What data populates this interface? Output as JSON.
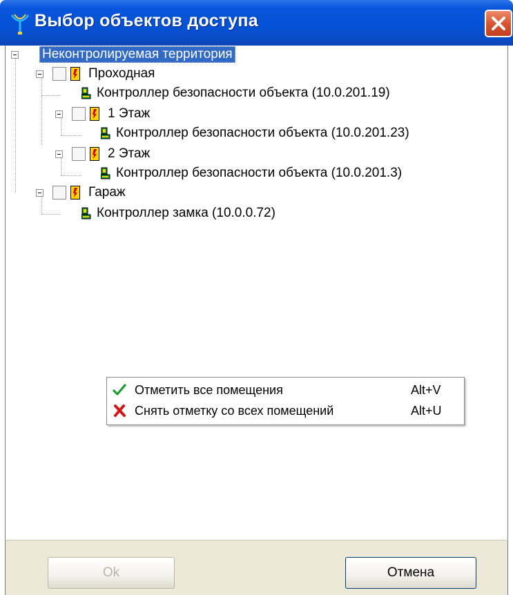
{
  "window": {
    "title": "Выбор объектов доступа"
  },
  "tree": {
    "root": {
      "label": "Неконтролируемая территория",
      "selected": true
    },
    "items": [
      {
        "label": "Проходная",
        "type": "zone",
        "checked": false
      },
      {
        "label": "Контроллер безопасности объекта (10.0.201.19)",
        "type": "controller"
      },
      {
        "label": "1 Этаж",
        "type": "zone",
        "checked": false
      },
      {
        "label": "Контроллер безопасности объекта (10.0.201.23)",
        "type": "controller"
      },
      {
        "label": "2 Этаж",
        "type": "zone",
        "checked": false
      },
      {
        "label": "Контроллер безопасности объекта (10.0.201.3)",
        "type": "controller"
      },
      {
        "label": "Гараж",
        "type": "zone",
        "checked": false
      },
      {
        "label": "Контроллер замка (10.0.0.72)",
        "type": "controller"
      }
    ]
  },
  "context_menu": {
    "items": [
      {
        "label": "Отметить все помещения",
        "shortcut": "Alt+V",
        "icon": "check-icon"
      },
      {
        "label": "Снять отметку со всех помещений",
        "shortcut": "Alt+U",
        "icon": "cross-icon"
      }
    ]
  },
  "buttons": {
    "ok": {
      "label": "Ok",
      "enabled": false
    },
    "cancel": {
      "label": "Отмена",
      "enabled": true
    }
  },
  "colors": {
    "titlebar": "#0552d6",
    "selection": "#316ac5",
    "panel": "#ece9d8"
  }
}
